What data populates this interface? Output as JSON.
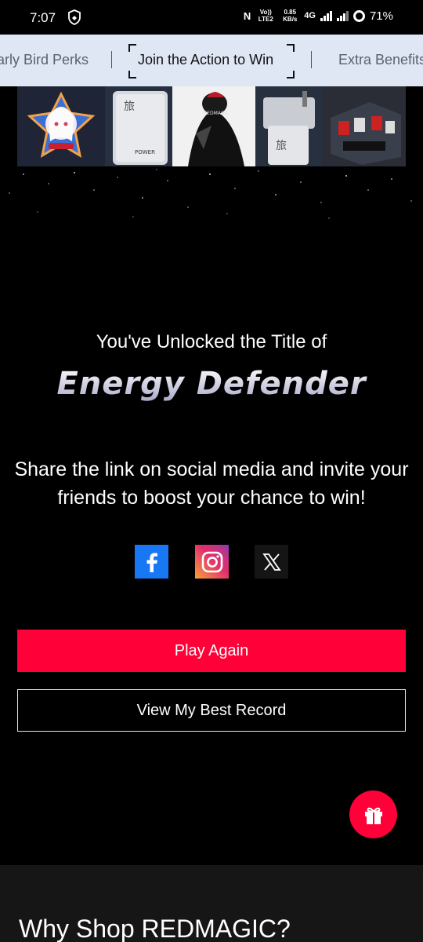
{
  "status_bar": {
    "time": "7:07",
    "network_top": "Vo)) LTE2",
    "speed": "0.85 KB/s",
    "network_type": "4G",
    "battery": "71%"
  },
  "tabs": {
    "left": "Early Bird Perks",
    "active": "Join the Action to Win",
    "right": "Extra Benefits"
  },
  "banner": {
    "panel_icons": [
      "anime-character-badge",
      "power-bank",
      "redmagic-figure",
      "charger-adapter",
      "gaming-room-set"
    ]
  },
  "result": {
    "unlock_text": "You've Unlocked the Title of",
    "title": "Energy Defender",
    "share_text": "Share the link on social media and invite your friends to boost your chance to win!"
  },
  "social": {
    "icons": [
      "facebook-icon",
      "instagram-icon",
      "x-icon"
    ],
    "colors": {
      "facebook": "#1877f2",
      "x": "#151515"
    }
  },
  "buttons": {
    "play_again": "Play Again",
    "view_record": "View My Best Record"
  },
  "fab": {
    "icon": "gift-icon",
    "color": "#ff0038"
  },
  "footer": {
    "heading": "Why Shop REDMAGIC?"
  },
  "colors": {
    "accent": "#ff0038",
    "tab_bg": "#dfe7f4"
  }
}
